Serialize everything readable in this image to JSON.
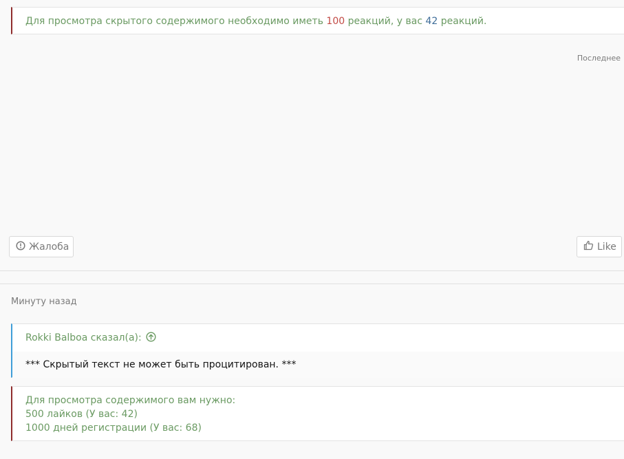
{
  "hidden_top": {
    "prefix": "Для просмотра скрытого содержимого необходимо иметь ",
    "required": "100",
    "middle": " реакций, у вас ",
    "current": "42",
    "suffix": " реакций."
  },
  "last_label": "Последнее",
  "actions": {
    "report_label": "Жалоба",
    "like_label": "Like"
  },
  "post": {
    "time": "Минуту назад",
    "quote": {
      "author_line": "Rokki Balboa сказал(а):",
      "body": "*** Скрытый текст не может быть процитирован. ***"
    },
    "requirements": {
      "title": "Для просмотра содержимого вам нужно:",
      "items": [
        "500 лайков (У вас: 42)",
        "1000 дней регистрации (У вас: 68)"
      ]
    }
  },
  "colors": {
    "accent_green": "#6a9a62",
    "warning_border": "#8f2d2d",
    "quote_border": "#3f9ed8",
    "number_red": "#c24a45",
    "number_blue": "#3d6c98"
  },
  "icons": {
    "report": "exclamation-circle-icon",
    "like": "thumbs-up-icon",
    "quote_jump": "arrow-up-circle-icon"
  }
}
